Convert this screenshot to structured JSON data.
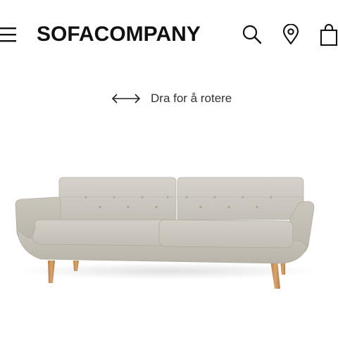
{
  "header": {
    "brand": "SOFACOMPANY",
    "menu_icon": "hamburger-menu-icon",
    "search_icon": "search-icon",
    "location_icon": "location-pin-icon",
    "bag_icon": "shopping-bag-icon"
  },
  "viewer": {
    "rotate_hint": "Dra for å rotere",
    "rotate_icon": "double-arrow-icon"
  },
  "product": {
    "image": "sofa-image",
    "fabric_color": "#cfcbc3",
    "leg_color": "#c8925a"
  }
}
